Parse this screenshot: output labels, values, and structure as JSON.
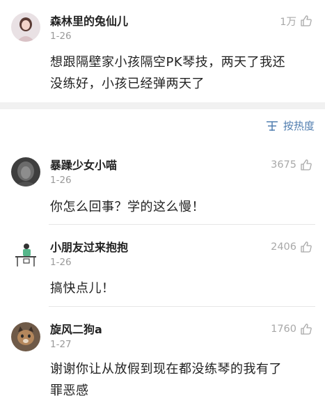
{
  "top_comment": {
    "name": "森林里的兔仙儿",
    "date": "1-26",
    "likes": "1万",
    "content_lines": [
      "想跟隔壁家小孩隔空PK琴技，两天了我还",
      "没练好，小孩已经弹两天了"
    ]
  },
  "sort": {
    "label": "按热度"
  },
  "replies": [
    {
      "name": "暴躁少女小喵",
      "date": "1-26",
      "likes": "3675",
      "content_lines": [
        "你怎么回事？学的这么慢！"
      ]
    },
    {
      "name": "小朋友过来抱抱",
      "date": "1-26",
      "likes": "2406",
      "content_lines": [
        "搞快点儿！"
      ]
    },
    {
      "name": "旋风二狗a",
      "date": "1-27",
      "likes": "1760",
      "content_lines": [
        "谢谢你让从放假到现在都没练琴的我有了",
        "罪恶感"
      ]
    }
  ],
  "colors": {
    "link": "#507daf",
    "meta": "#9a9a9a",
    "band": "#f1f1f1"
  }
}
